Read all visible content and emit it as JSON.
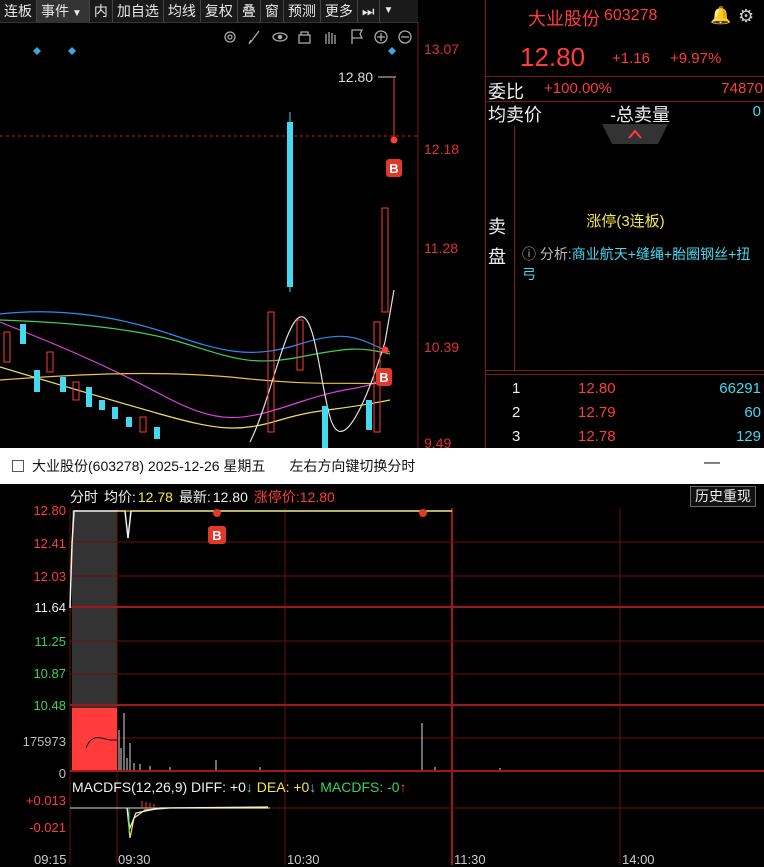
{
  "toolbar": {
    "items": [
      "连板",
      "事件",
      "内",
      "加自选",
      "均线",
      "复权",
      "叠",
      "窗",
      "预测",
      "更多"
    ],
    "selected": "事件"
  },
  "kline": {
    "price_ticks": [
      "13.07",
      "12.18",
      "11.28",
      "10.39",
      "9.49"
    ],
    "last_price_tag": "12.80",
    "buy_marker": "B"
  },
  "quote": {
    "name": "大业股份",
    "code": "603278",
    "price": "12.80",
    "change": "+1.16",
    "change_pct": "+9.97%",
    "ratio_label": "委比",
    "ratio_value": "+100.00%",
    "ratio_volume": "74870",
    "avg_sell_label": "均卖价",
    "total_sell_label": "总卖量",
    "total_sell_value": "0",
    "sell_panel_label": [
      "卖",
      "盘"
    ],
    "limit_text": "涨停(3连板)",
    "analysis_prefix": "分析:",
    "analysis_text": "商业航天+缝绳+胎圈钢丝+扭弓",
    "bids": [
      {
        "level": "1",
        "price": "12.80",
        "volume": "66291"
      },
      {
        "level": "2",
        "price": "12.79",
        "volume": "60"
      },
      {
        "level": "3",
        "price": "12.78",
        "volume": "129"
      }
    ],
    "colors": {
      "up": "#ff3b3b",
      "down": "#43d9f0",
      "highlight": "#f5e84a"
    }
  },
  "intraday": {
    "window_title": "大业股份(603278) 2025-12-26 星期五",
    "hint": "左右方向键切换分时",
    "close_glyph": "—",
    "legend": {
      "label_fenshi": "分时",
      "avg_label": "均价:",
      "avg_value": "12.78",
      "latest_label": "最新:",
      "latest_value": "12.80",
      "limit_label": "涨停价:",
      "limit_value": "12.80"
    },
    "history_button": "历史重现",
    "y_ticks_up": [
      "12.80",
      "12.41",
      "12.03"
    ],
    "y_tick_base": "11.64",
    "y_ticks_down": [
      "11.25",
      "10.87",
      "10.48"
    ],
    "volume_tick": "175973",
    "volume_zero": "0",
    "macd_legend": {
      "name": "MACDFS(12,26,9)",
      "diff": "DIFF: +0",
      "dea": "DEA: +0",
      "macdfs": "MACDFS: -0"
    },
    "macd_ticks": [
      "+0.013",
      "-0.021"
    ],
    "x_ticks": [
      "09:15",
      "09:30",
      "10:30",
      "11:30",
      "14:00"
    ],
    "buy_marker": "B"
  }
}
